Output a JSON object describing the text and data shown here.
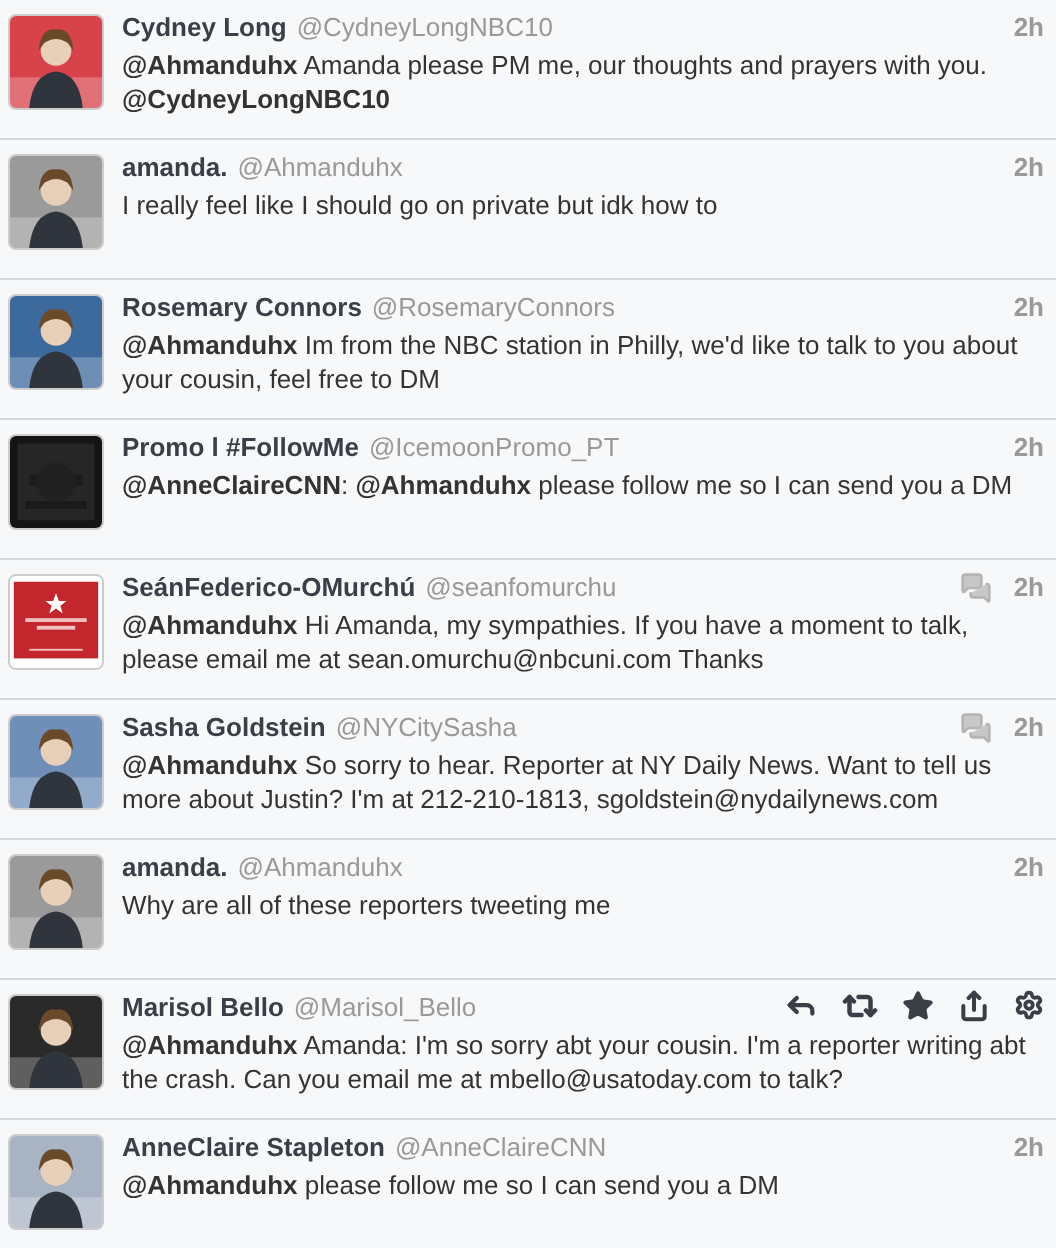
{
  "tweets": [
    {
      "name": "Cydney Long",
      "handle": "@CydneyLongNBC10",
      "time": "2h",
      "text": "**@Ahmanduhx** Amanda please PM me, our thoughts and prayers with you. **@CydneyLongNBC10**",
      "conversation": false,
      "actions_visible": false,
      "avatar": {
        "kind": "person",
        "color": "#d8424a"
      }
    },
    {
      "name": "amanda.",
      "handle": "@Ahmanduhx",
      "time": "2h",
      "text": "I really feel like I should go on private but idk how to",
      "conversation": false,
      "actions_visible": false,
      "avatar": {
        "kind": "person",
        "color": "#9a9a9a"
      }
    },
    {
      "name": "Rosemary Connors",
      "handle": "@RosemaryConnors",
      "time": "2h",
      "text": "**@Ahmanduhx** Im from the NBC station in Philly, we'd like to talk to you about your cousin, feel free to DM",
      "conversation": false,
      "actions_visible": false,
      "avatar": {
        "kind": "person",
        "color": "#3d6a9c"
      }
    },
    {
      "name": "Promo l #FollowMe",
      "handle": "@IcemoonPromo_PT",
      "time": "2h",
      "text": "**@AnneClaireCNN**: **@Ahmanduhx** please follow me so I can send you a DM",
      "conversation": false,
      "actions_visible": false,
      "avatar": {
        "kind": "dark",
        "color": "#151515"
      }
    },
    {
      "name": "SeánFederico-OMurchú",
      "handle": "@seanfomurchu",
      "time": "2h",
      "text": "**@Ahmanduhx** Hi Amanda, my sympathies. If you have a moment to talk, please email me at sean.omurchu@nbcuni.com Thanks",
      "conversation": true,
      "actions_visible": false,
      "avatar": {
        "kind": "banner",
        "color": "#c4262e"
      }
    },
    {
      "name": "Sasha Goldstein",
      "handle": "@NYCitySasha",
      "time": "2h",
      "text": "**@Ahmanduhx** So sorry to hear. Reporter at NY Daily News. Want to tell us more about Justin? I'm at 212-210-1813, sgoldstein@nydailynews.com",
      "conversation": true,
      "actions_visible": false,
      "avatar": {
        "kind": "person",
        "color": "#6f8fb8"
      }
    },
    {
      "name": "amanda.",
      "handle": "@Ahmanduhx",
      "time": "2h",
      "text": "Why are all of these reporters tweeting me",
      "conversation": false,
      "actions_visible": false,
      "avatar": {
        "kind": "person",
        "color": "#9a9a9a"
      }
    },
    {
      "name": "Marisol Bello",
      "handle": "@Marisol_Bello",
      "text": "**@Ahmanduhx** Amanda: I'm so sorry abt your cousin. I'm a reporter writing abt the crash. Can you email me at mbello@usatoday.com to talk?",
      "conversation": false,
      "actions_visible": true,
      "avatar": {
        "kind": "person",
        "color": "#2a2a2a"
      }
    },
    {
      "name": "AnneClaire Stapleton",
      "handle": "@AnneClaireCNN",
      "time": "2h",
      "text": "**@Ahmanduhx** please follow me so I can send you a DM",
      "conversation": false,
      "actions_visible": false,
      "avatar": {
        "kind": "person",
        "color": "#a8b4c4"
      }
    }
  ]
}
